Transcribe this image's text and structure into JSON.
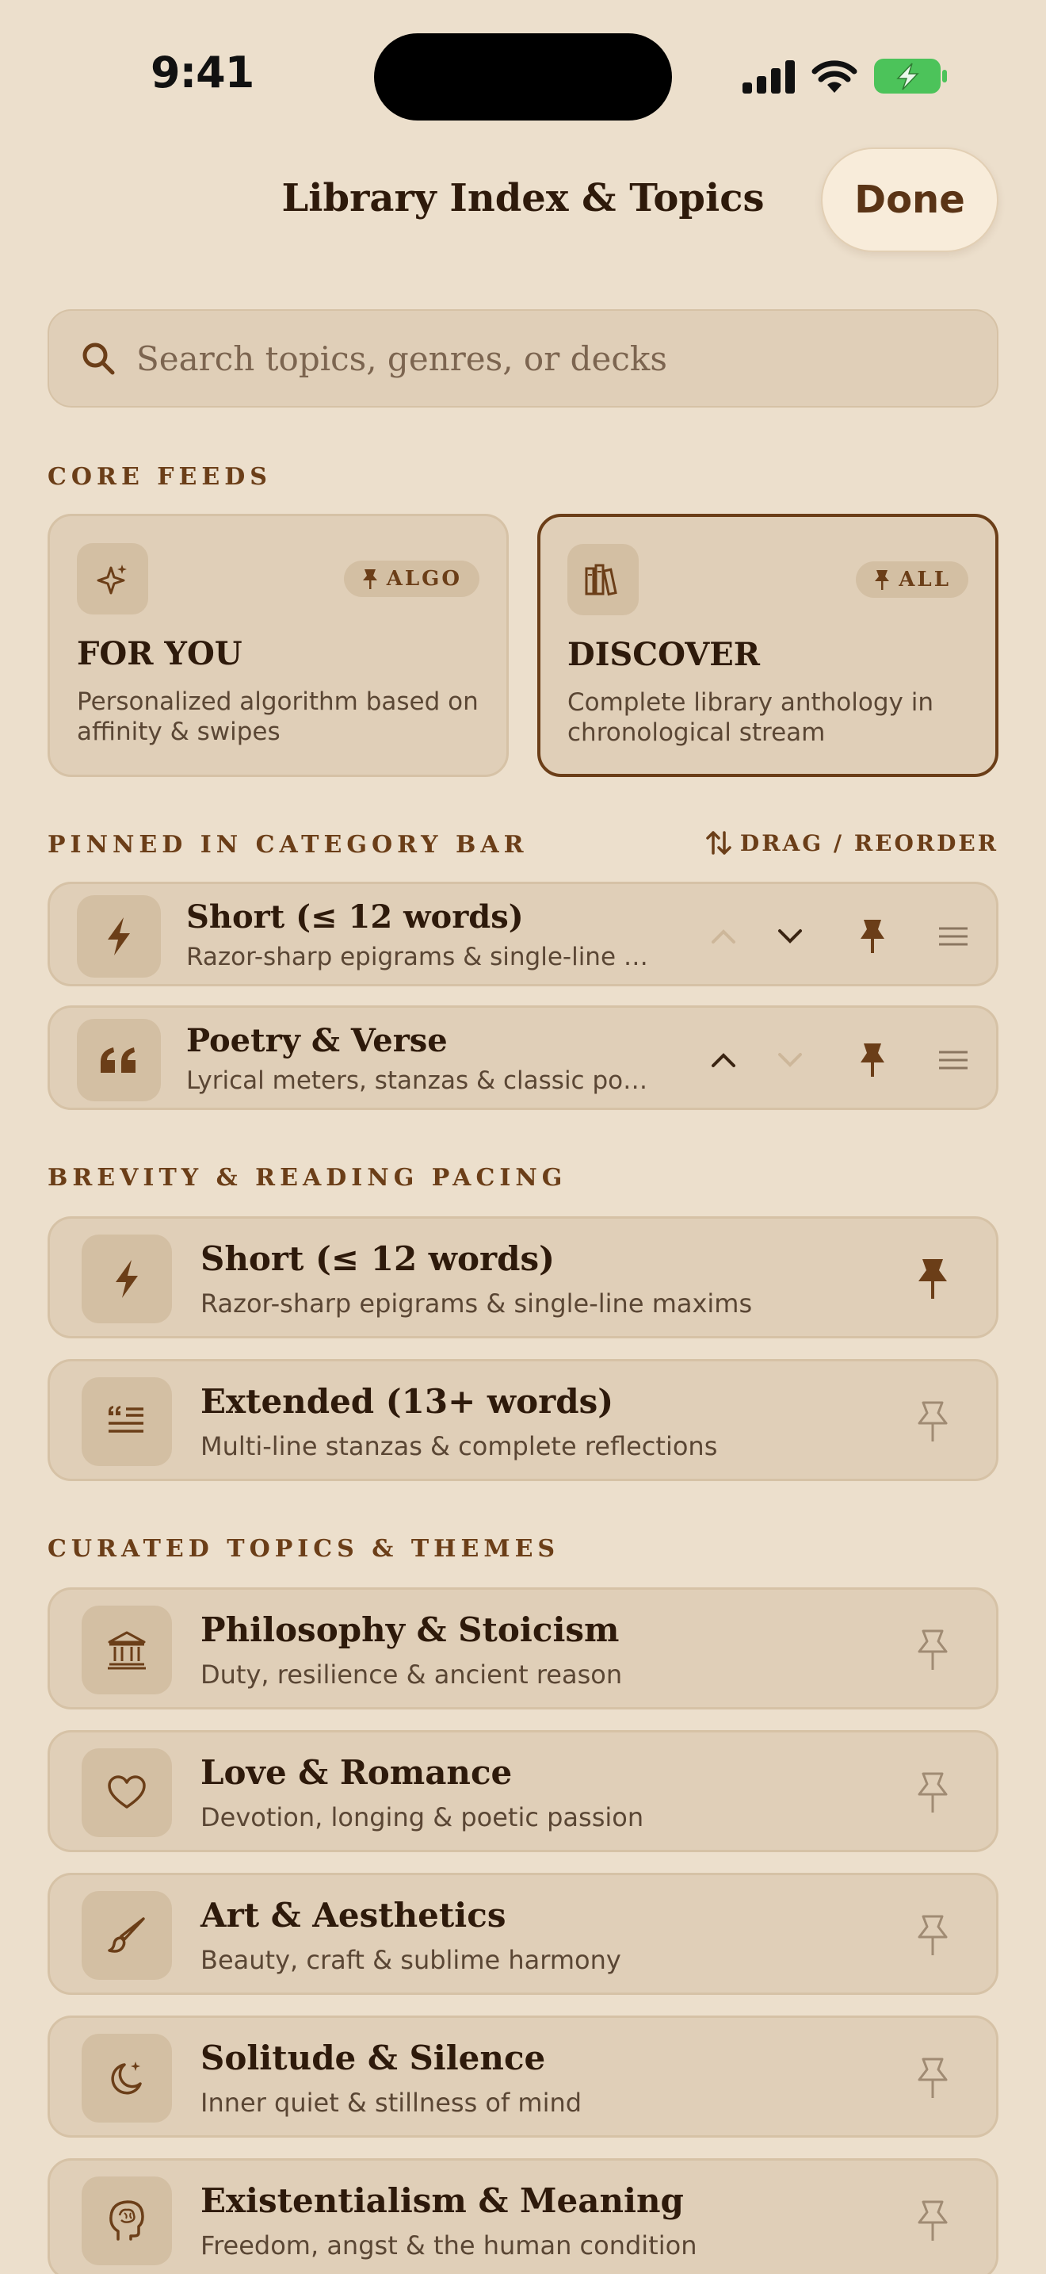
{
  "status_bar": {
    "time": "9:41"
  },
  "header": {
    "title": "Library Index & Topics",
    "done_label": "Done"
  },
  "search": {
    "placeholder": "Search topics, genres, or decks"
  },
  "core_feeds": {
    "label": "CORE FEEDS",
    "cards": [
      {
        "title": "FOR YOU",
        "badge": "ALGO",
        "description": "Personalized algorithm based on affinity & swipes",
        "icon": "sparkle-icon",
        "active": false
      },
      {
        "title": "DISCOVER",
        "badge": "ALL",
        "description": "Complete library anthology in chronological stream",
        "icon": "books-icon",
        "active": true
      }
    ]
  },
  "pinned": {
    "label": "PINNED IN CATEGORY BAR",
    "reorder_hint": "DRAG / REORDER",
    "items": [
      {
        "title": "Short (≤ 12 words)",
        "subtitle": "Razor-sharp epigrams & single-line maxims",
        "icon": "bolt-icon",
        "up_enabled": false,
        "down_enabled": true
      },
      {
        "title": "Poetry & Verse",
        "subtitle": "Lyrical meters, stanzas & classic poetry",
        "icon": "quote-icon",
        "up_enabled": true,
        "down_enabled": false
      }
    ]
  },
  "brevity": {
    "label": "BREVITY & READING PACING",
    "items": [
      {
        "title": "Short (≤ 12 words)",
        "subtitle": "Razor-sharp epigrams & single-line maxims",
        "icon": "bolt-icon",
        "pinned": true
      },
      {
        "title": "Extended (13+ words)",
        "subtitle": "Multi-line stanzas & complete reflections",
        "icon": "text-lines-icon",
        "pinned": false
      }
    ]
  },
  "topics": {
    "label": "CURATED TOPICS & THEMES",
    "items": [
      {
        "title": "Philosophy & Stoicism",
        "subtitle": "Duty, resilience & ancient reason",
        "icon": "columns-icon",
        "pinned": false
      },
      {
        "title": "Love & Romance",
        "subtitle": "Devotion, longing & poetic passion",
        "icon": "heart-icon",
        "pinned": false
      },
      {
        "title": "Art & Aesthetics",
        "subtitle": "Beauty, craft & sublime harmony",
        "icon": "brush-icon",
        "pinned": false
      },
      {
        "title": "Solitude & Silence",
        "subtitle": "Inner quiet & stillness of mind",
        "icon": "moon-icon",
        "pinned": false
      },
      {
        "title": "Existentialism & Meaning",
        "subtitle": "Freedom, angst & the human condition",
        "icon": "head-icon",
        "pinned": false
      }
    ]
  },
  "colors": {
    "background": "#ecdfcc",
    "card": "#e0cfb8",
    "accent": "#6b3e18",
    "battery": "#4cc35a"
  }
}
